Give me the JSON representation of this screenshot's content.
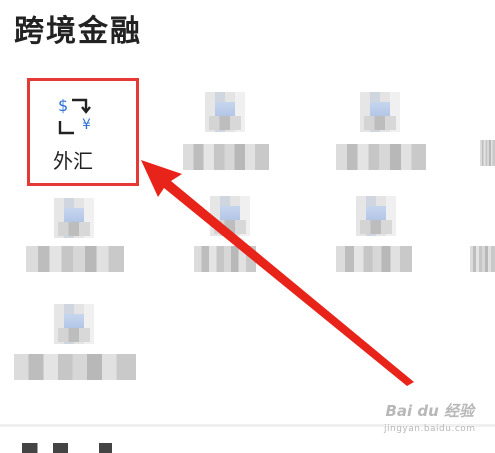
{
  "section": {
    "title": "跨境金融"
  },
  "featured_item": {
    "label": "外汇",
    "icon": "currency-exchange-icon",
    "currency_symbols": [
      "$",
      "¥"
    ],
    "accent_color": "#2f6fd6",
    "highlight_color": "#e53935"
  },
  "annotation": {
    "arrow_color": "#e8231a"
  },
  "watermark": {
    "brand": "Bai du 经验",
    "sub": "jingyan.baidu.com"
  }
}
